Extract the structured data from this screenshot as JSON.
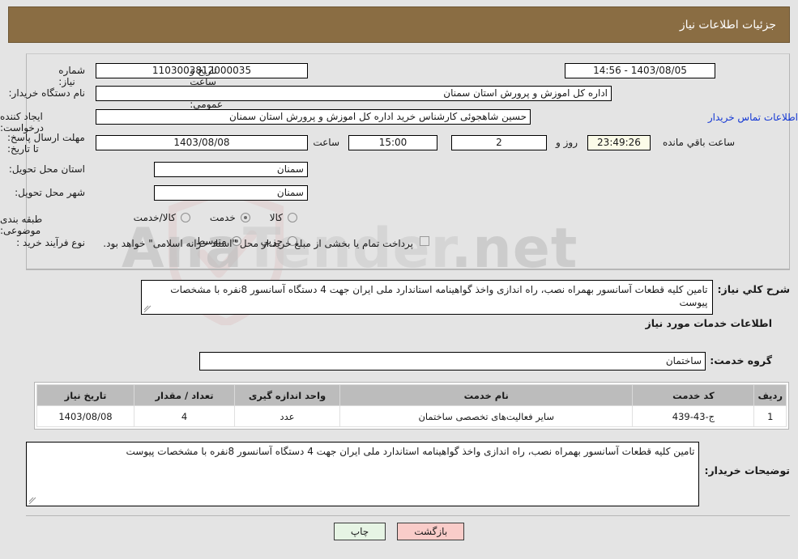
{
  "header": {
    "title": "جزئیات اطلاعات نیاز"
  },
  "watermark": {
    "text_left": "Ana",
    "text_mid": "Tender",
    "text_right": ".net"
  },
  "form": {
    "need_number": {
      "label": "شماره نیاز:",
      "value": "1103003812000035"
    },
    "public_announce": {
      "label": "تاریخ و ساعت اعلان عمومی:",
      "value": "1403/08/05 - 14:56"
    },
    "buyer_org": {
      "label": "نام دستگاه خریدار:",
      "value": "اداره کل اموزش و پرورش استان سمنان"
    },
    "requester": {
      "label": "ایجاد کننده درخواست:",
      "value": "حسین شاهجوئی کارشناس خرید اداره کل اموزش و پرورش استان سمنان"
    },
    "contact_link": "اطلاعات تماس خریدار",
    "deadline": {
      "label": "مهلت ارسال پاسخ: تا تاریخ:",
      "date": "1403/08/08",
      "time_label": "ساعت",
      "time": "15:00",
      "days": "2",
      "days_label": "روز و",
      "countdown": "23:49:26",
      "countdown_label": "ساعت باقي مانده"
    },
    "province": {
      "label": "استان محل تحویل:",
      "value": "سمنان"
    },
    "city": {
      "label": "شهر محل تحویل:",
      "value": "سمنان"
    },
    "category": {
      "label": "طبقه بندی موضوعی:",
      "options": [
        {
          "label": "کالا",
          "selected": false
        },
        {
          "label": "خدمت",
          "selected": true
        },
        {
          "label": "کالا/خدمت",
          "selected": false
        }
      ]
    },
    "purchase_type": {
      "label": "نوع فرآیند خرید :",
      "options": [
        {
          "label": "جزیي",
          "selected": false
        },
        {
          "label": "متوسط",
          "selected": true
        }
      ],
      "checkbox_label": "پرداخت تمام یا بخشی از مبلغ خرید،از محل \"اسناد خزانه اسلامی\" خواهد بود.",
      "checkbox_checked": false
    }
  },
  "summary": {
    "label": "شرح کلي نیاز:",
    "value": "تامین کلیه قطعات آسانسور بهمراه نصب، راه اندازی واخذ گواهینامه استاندارد ملی ایران جهت 4 دستگاه آسانسور 8نفره با مشخصات پیوست"
  },
  "services_section": {
    "heading": "اطلاعات خدمات مورد نیاز",
    "service_group": {
      "label": "گروه خدمت:",
      "value": "ساختمان"
    }
  },
  "table": {
    "columns": [
      "ردیف",
      "کد خدمت",
      "نام خدمت",
      "واحد اندازه گیری",
      "تعداد / مقدار",
      "تاریخ نیاز"
    ],
    "rows": [
      {
        "row_no": "1",
        "service_code": "ج-43-439",
        "service_name": "سایر فعالیت‌های تخصصی ساختمان",
        "unit": "عدد",
        "quantity": "4",
        "need_date": "1403/08/08"
      }
    ]
  },
  "buyer_notes": {
    "label": "توضیحات خریدار:",
    "value": "تامین کلیه قطعات آسانسور بهمراه نصب، راه اندازی واخذ گواهینامه استاندارد ملی ایران جهت 4 دستگاه آسانسور 8نفره با مشخصات پیوست"
  },
  "footer": {
    "print_label": "چاپ",
    "back_label": "بازگشت"
  },
  "colors": {
    "header_bg": "#8a6d43",
    "page_bg": "#e4e4e4",
    "link": "#1337d4",
    "table_header_bg": "#bcbcbc",
    "print_btn_bg": "#e6f4e4",
    "back_btn_bg": "#f9ccc9",
    "countdown_bg": "#fbfbe8"
  }
}
